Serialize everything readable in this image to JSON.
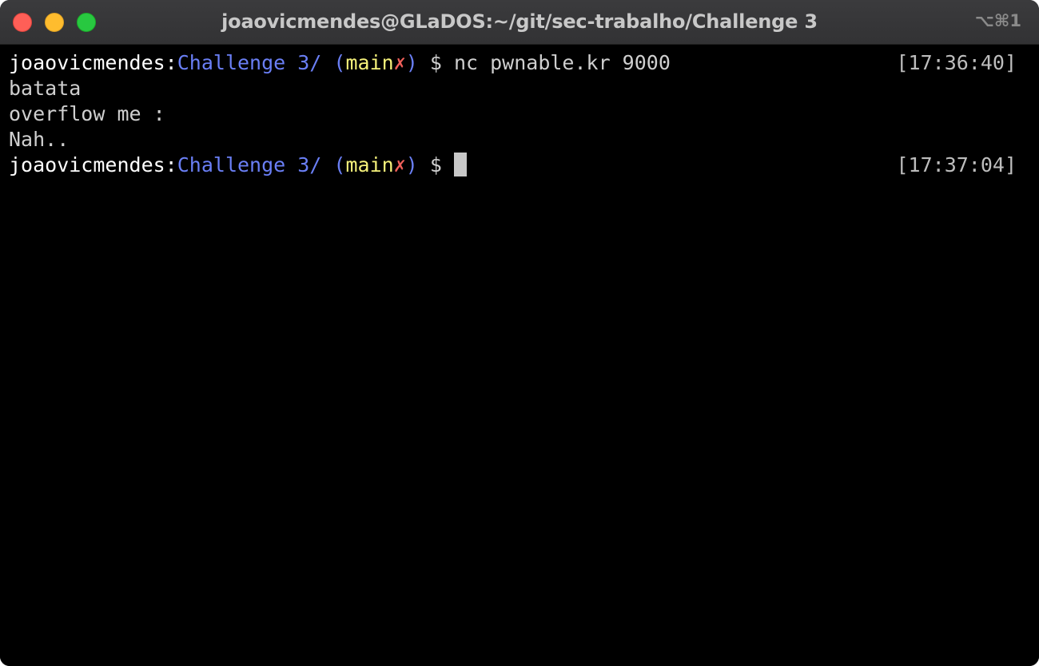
{
  "window": {
    "title": "joaovicmendes@GLaDOS:~/git/sec-trabalho/Challenge 3",
    "shortcut": "⌥⌘1"
  },
  "terminal": {
    "prompt1": {
      "user": "joaovicmendes",
      "colon": ":",
      "path": "Challenge 3/",
      "paren_open": " (",
      "branch": "main",
      "dirty": "✗",
      "paren_close": ")",
      "dollar": " $ ",
      "command": "nc pwnable.kr 9000",
      "time": "[17:36:40]"
    },
    "output": [
      "batata",
      "overflow me :",
      "Nah.."
    ],
    "prompt2": {
      "user": "joaovicmendes",
      "colon": ":",
      "path": "Challenge 3/",
      "paren_open": " (",
      "branch": "main",
      "dirty": "✗",
      "paren_close": ")",
      "dollar": " $ ",
      "time": "[17:37:04]"
    }
  },
  "colors": {
    "background": "#000000",
    "path": "#6a7ff5",
    "branch": "#f5f17a",
    "dirty": "#f0605a",
    "text": "#cfcfcf"
  }
}
